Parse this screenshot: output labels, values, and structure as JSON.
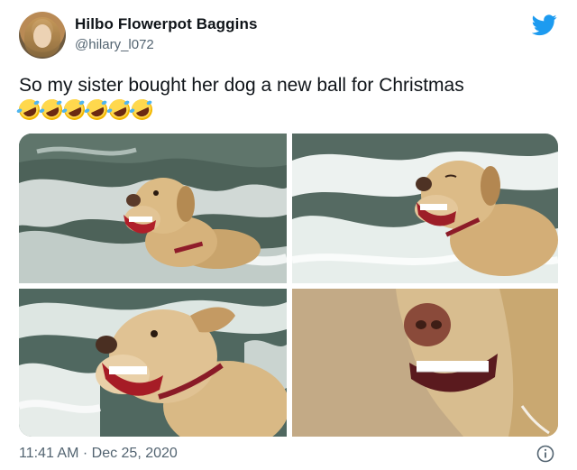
{
  "tweet": {
    "display_name": "Hilbo Flowerpot Baggins",
    "handle": "@hilary_l072",
    "text": "So my sister bought her dog a new ball for Christmas",
    "emojis": [
      "rolling-on-floor-laughing",
      "rolling-on-floor-laughing",
      "rolling-on-floor-laughing",
      "rolling-on-floor-laughing",
      "rolling-on-floor-laughing",
      "rolling-on-floor-laughing"
    ],
    "timestamp": "11:41 AM · Dec 25, 2020"
  },
  "icons": {
    "brand": "twitter-bird-icon",
    "info": "info-icon"
  },
  "colors": {
    "twitter_blue": "#1d9bf0",
    "secondary_text": "#536471",
    "primary_text": "#0f1419"
  }
}
